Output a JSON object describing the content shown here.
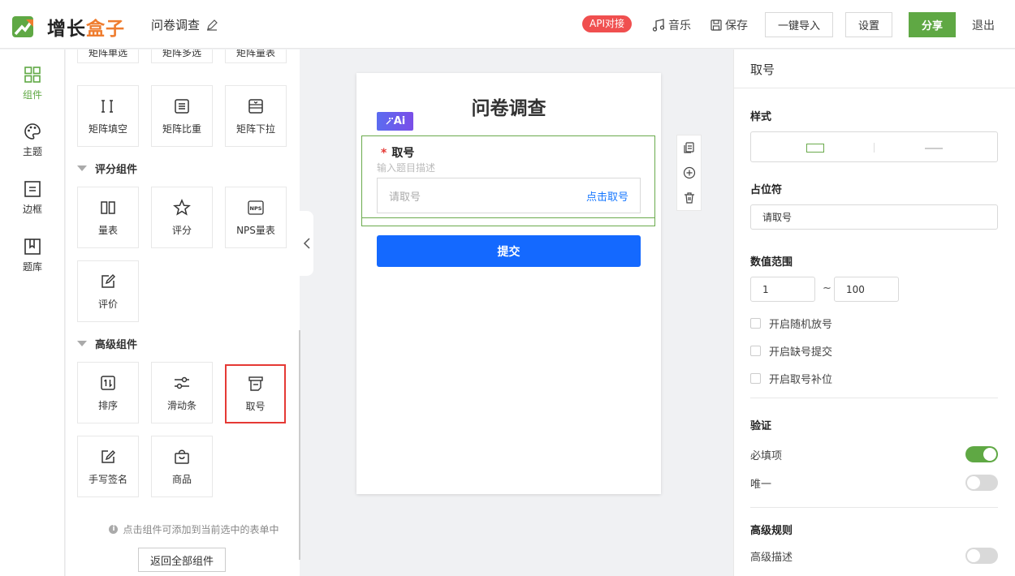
{
  "brand": {
    "name_a": "增长",
    "name_b": "盒子"
  },
  "header": {
    "doc_title": "问卷调查",
    "api_badge": "API对接",
    "music": "音乐",
    "save": "保存",
    "import": "一键导入",
    "settings": "设置",
    "share": "分享",
    "logout": "退出"
  },
  "nav": [
    {
      "label": "组件",
      "icon": "grid-icon",
      "active": true
    },
    {
      "label": "主题",
      "icon": "palette-icon"
    },
    {
      "label": "边框",
      "icon": "border-icon"
    },
    {
      "label": "题库",
      "icon": "library-icon"
    }
  ],
  "components": {
    "matrix_top": [
      "矩阵单选",
      "矩阵多选",
      "矩阵量表"
    ],
    "matrix": [
      "矩阵填空",
      "矩阵比重",
      "矩阵下拉"
    ],
    "rating_section": "评分组件",
    "rating": [
      "量表",
      "评分",
      "NPS量表",
      "评价"
    ],
    "advanced_section": "高级组件",
    "advanced": [
      "排序",
      "滑动条",
      "取号",
      "手写签名",
      "商品"
    ],
    "nps_icon_text": "NPS",
    "hint": "点击组件可添加到当前选中的表单中",
    "back_button": "返回全部组件"
  },
  "survey": {
    "title": "问卷调查",
    "ai_badge": "Ai",
    "question_label": "取号",
    "required_mark": "*",
    "description_placeholder": "输入题目描述",
    "input_placeholder": "请取号",
    "input_action": "点击取号",
    "submit": "提交"
  },
  "props": {
    "title": "取号",
    "style_label": "样式",
    "placeholder_label": "占位符",
    "placeholder_value": "请取号",
    "range_label": "数值范围",
    "range_min": "1",
    "range_sep": "~",
    "range_max": "100",
    "checkboxes": [
      "开启随机放号",
      "开启缺号提交",
      "开启取号补位"
    ],
    "validation_label": "验证",
    "required_label": "必填项",
    "required_on": true,
    "unique_label": "唯一",
    "unique_on": false,
    "advanced_label": "高级规则",
    "advanced_desc_label": "高级描述",
    "advanced_desc_on": false
  },
  "colors": {
    "brand_green": "#5fa844",
    "brand_orange": "#ef7d2f",
    "primary_blue": "#1469ff",
    "danger": "#f04f4f"
  }
}
